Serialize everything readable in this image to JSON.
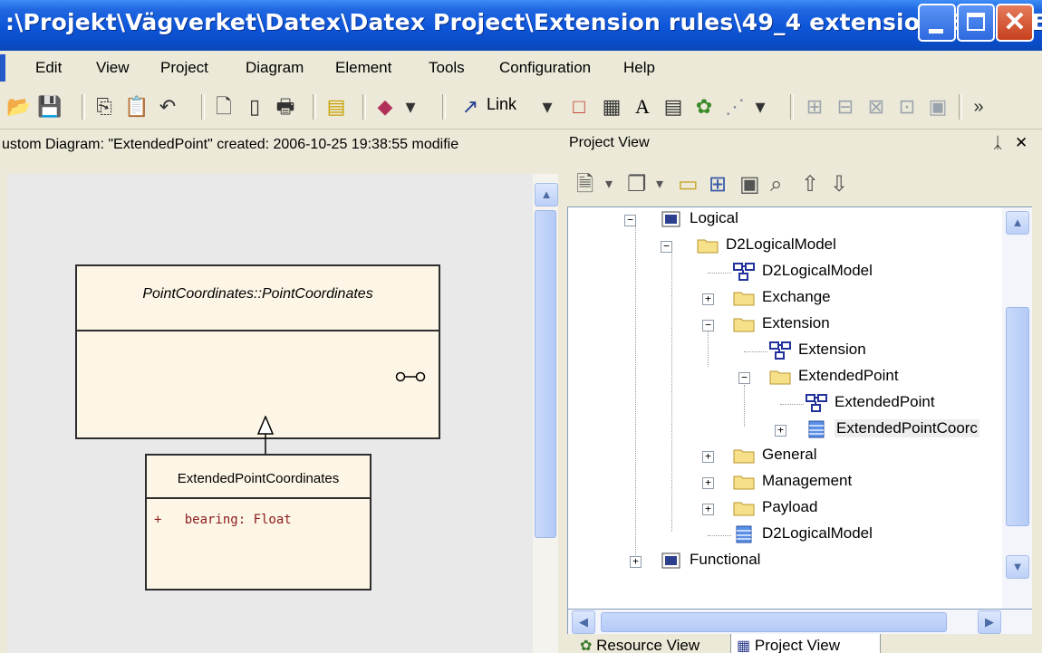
{
  "window": {
    "title": ":\\Projekt\\Vägverket\\Datex\\Datex Project\\Extension rules\\49_4 extension.EAP] - EA",
    "close_glyph": "✕"
  },
  "menu": {
    "items": [
      "Edit",
      "View",
      "Project",
      "Diagram",
      "Element",
      "Tools",
      "Configuration",
      "Help"
    ]
  },
  "toolbar": {
    "link_label": "Link",
    "overflow": "»"
  },
  "diagram": {
    "status": "ustom Diagram: \"ExtendedPoint\"  created: 2006-10-25 19:38:55  modifie",
    "class1": {
      "name": "PointCoordinates::PointCoordinates"
    },
    "class2": {
      "name": "ExtendedPointCoordinates",
      "attributes": [
        "+   bearing: Float"
      ]
    }
  },
  "project_view": {
    "title": "Project View",
    "pin": "ᛣ",
    "close": "✕",
    "tree": [
      {
        "label": "Logical",
        "icon": "package-icon"
      },
      {
        "label": "D2LogicalModel",
        "icon": "folder-icon"
      },
      {
        "label": "D2LogicalModel",
        "icon": "diagram-icon"
      },
      {
        "label": "Exchange",
        "icon": "folder-icon"
      },
      {
        "label": "Extension",
        "icon": "folder-icon"
      },
      {
        "label": "Extension",
        "icon": "diagram-icon"
      },
      {
        "label": "ExtendedPoint",
        "icon": "folder-icon"
      },
      {
        "label": "ExtendedPoint",
        "icon": "diagram-icon"
      },
      {
        "label": "ExtendedPointCoorc",
        "icon": "class-icon"
      },
      {
        "label": "General",
        "icon": "folder-icon"
      },
      {
        "label": "Management",
        "icon": "folder-icon"
      },
      {
        "label": "Payload",
        "icon": "folder-icon"
      },
      {
        "label": "D2LogicalModel",
        "icon": "class-icon"
      },
      {
        "label": "Functional",
        "icon": "package-icon"
      }
    ],
    "tabs": [
      "Resource View",
      "Project View"
    ]
  },
  "colors": {
    "titlebar": "#0a4cc7",
    "class_fill": "#fdf6e6",
    "attribute_text": "#8b1a1a"
  }
}
